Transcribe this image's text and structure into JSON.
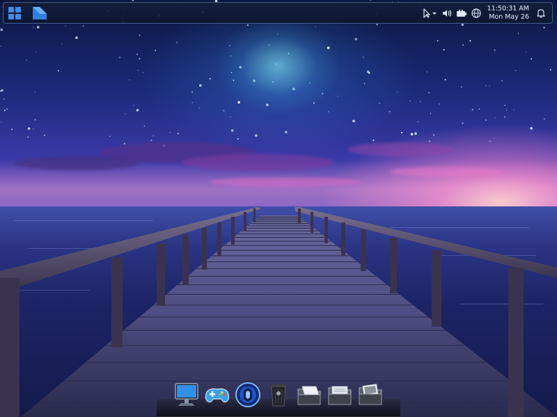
{
  "panel": {
    "start_icon": "windows-start-icon",
    "app_icon": "app-launcher-icon",
    "tray": {
      "icons": [
        "cursor-icon",
        "volume-icon",
        "battery-icon",
        "network-globe-icon",
        "notification-bell-icon"
      ]
    },
    "clock": {
      "time": "11:50:31 AM",
      "date": "Mon May 26"
    }
  },
  "dock": {
    "items": [
      {
        "name": "computer",
        "icon": "computer-monitor-icon"
      },
      {
        "name": "games",
        "icon": "gamepad-icon"
      },
      {
        "name": "browser",
        "icon": "globe-orb-icon"
      },
      {
        "name": "trash",
        "icon": "trash-can-icon"
      },
      {
        "name": "mail",
        "icon": "mail-folder-icon"
      },
      {
        "name": "documents",
        "icon": "documents-folder-icon"
      },
      {
        "name": "pictures",
        "icon": "pictures-folder-icon"
      }
    ]
  },
  "colors": {
    "panel_bg": "#14203c",
    "accent_blue": "#2f7fe6"
  }
}
